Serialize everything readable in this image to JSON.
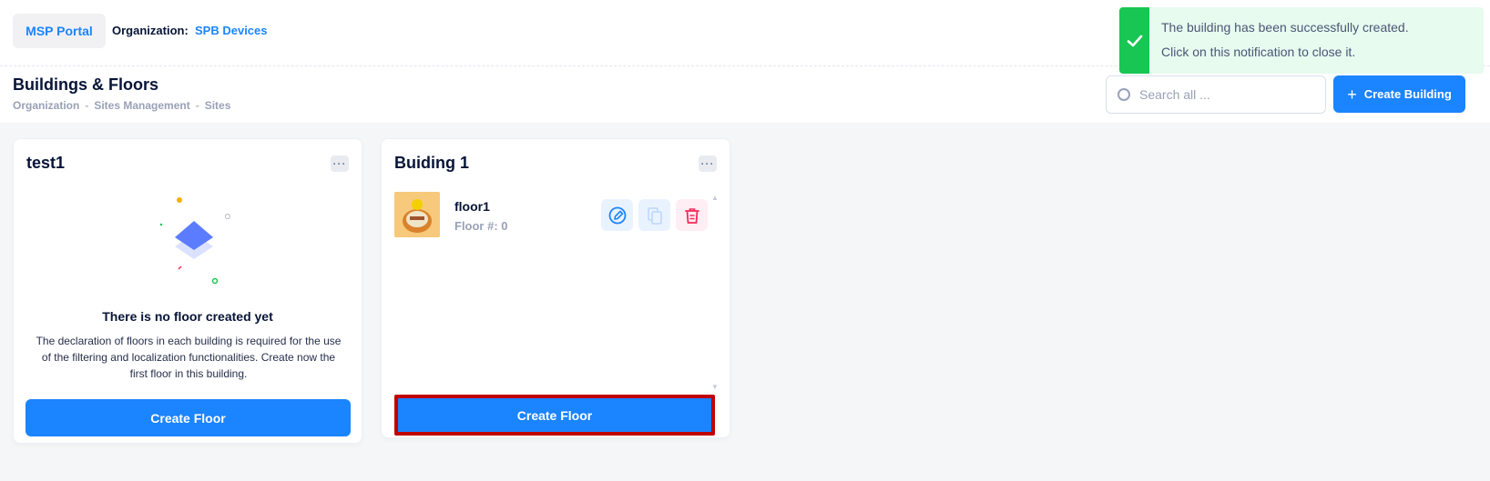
{
  "header": {
    "portal_label": "MSP Portal",
    "org_label": "Organization:",
    "org_value": "SPB Devices"
  },
  "toolbar": {
    "title": "Buildings & Floors",
    "breadcrumb": [
      "Organization",
      "Sites Management",
      "Sites"
    ],
    "breadcrumb_sep": "-",
    "search_placeholder": "Search all ...",
    "create_building_label": "Create Building"
  },
  "buildings": [
    {
      "name": "test1",
      "menu_label": "···",
      "empty_title": "There is no floor created yet",
      "empty_desc": "The declaration of floors in each building is required for the use of the filtering and localization functionalities. Create now the first floor in this building.",
      "create_floor_label": "Create Floor"
    },
    {
      "name": "Buiding 1",
      "menu_label": "···",
      "floors": [
        {
          "name": "floor1",
          "number_label": "Floor #: 0"
        }
      ],
      "create_floor_label": "Create Floor"
    }
  ],
  "toast": {
    "line1": "The building has been successfully created.",
    "line2": "Click on this notification to close it."
  },
  "colors": {
    "primary": "#1b84ff",
    "success": "#17c653",
    "danger": "#f8285a",
    "highlight": "#c00000"
  }
}
